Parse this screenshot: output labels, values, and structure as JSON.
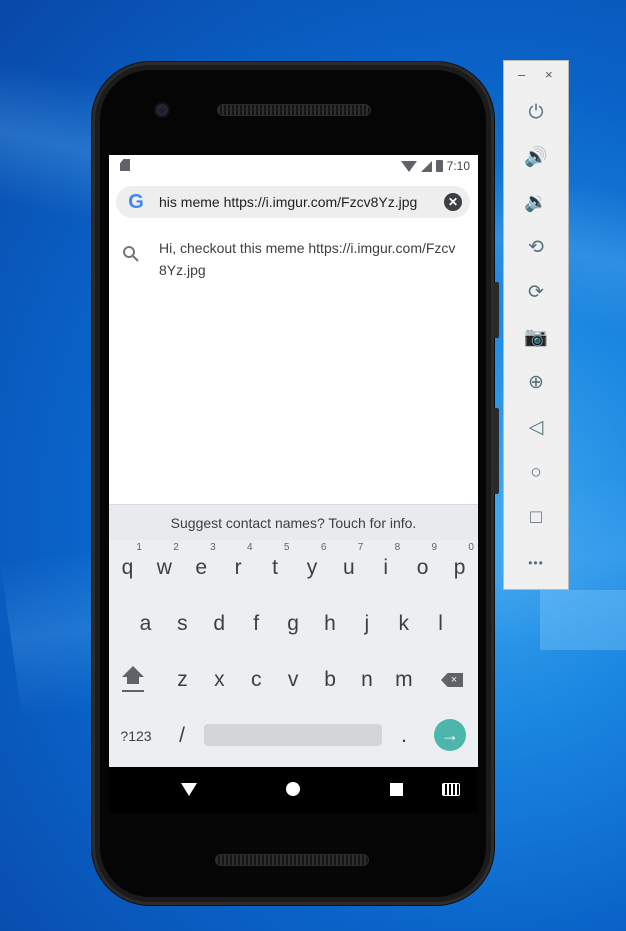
{
  "statusbar": {
    "time": "7:10"
  },
  "search": {
    "query": "his meme https://i.imgur.com/Fzcv8Yz.jpg",
    "logo": "G",
    "clear_icon": "✕"
  },
  "suggestion": {
    "text": "Hi, checkout this meme https://i.imgur.com/Fzcv8Yz.jpg"
  },
  "keyboard": {
    "hint": "Suggest contact names? Touch for info.",
    "row1": [
      {
        "k": "q",
        "n": "1"
      },
      {
        "k": "w",
        "n": "2"
      },
      {
        "k": "e",
        "n": "3"
      },
      {
        "k": "r",
        "n": "4"
      },
      {
        "k": "t",
        "n": "5"
      },
      {
        "k": "y",
        "n": "6"
      },
      {
        "k": "u",
        "n": "7"
      },
      {
        "k": "i",
        "n": "8"
      },
      {
        "k": "o",
        "n": "9"
      },
      {
        "k": "p",
        "n": "0"
      }
    ],
    "row2": [
      "a",
      "s",
      "d",
      "f",
      "g",
      "h",
      "j",
      "k",
      "l"
    ],
    "row3": [
      "z",
      "x",
      "c",
      "v",
      "b",
      "n",
      "m"
    ],
    "symbols_label": "?123",
    "slash": "/",
    "period": ".",
    "enter_icon": "→"
  },
  "toolbar": {
    "minimize": "–",
    "close": "×",
    "buttons": [
      {
        "name": "power-icon",
        "glyph": "⏻"
      },
      {
        "name": "volume-up-icon",
        "glyph": "🔊"
      },
      {
        "name": "volume-down-icon",
        "glyph": "🔉"
      },
      {
        "name": "rotate-left-icon",
        "glyph": "⟲"
      },
      {
        "name": "rotate-right-icon",
        "glyph": "⟳"
      },
      {
        "name": "camera-icon",
        "glyph": "📷"
      },
      {
        "name": "zoom-icon",
        "glyph": "⊕"
      },
      {
        "name": "back-icon",
        "glyph": "◁"
      },
      {
        "name": "home-icon",
        "glyph": "○"
      },
      {
        "name": "overview-icon",
        "glyph": "□"
      },
      {
        "name": "more-icon",
        "glyph": "•••"
      }
    ]
  }
}
